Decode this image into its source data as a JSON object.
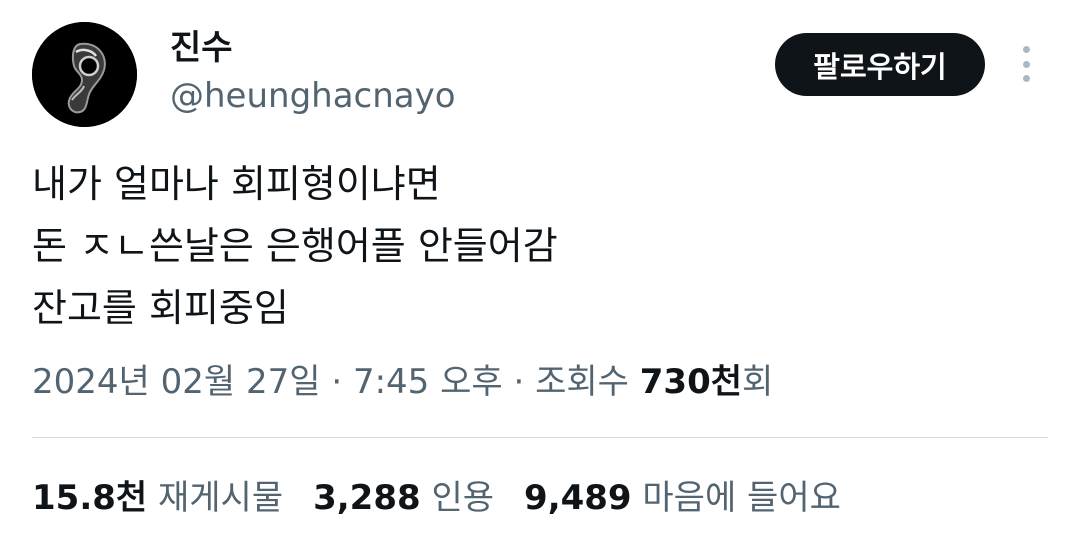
{
  "user": {
    "display_name": "진수",
    "handle": "@heunghacnayo",
    "avatar_icon": "dark-spiral-avatar"
  },
  "header": {
    "follow_label": "팔로우하기",
    "more_icon": "vertical-ellipsis-icon"
  },
  "tweet": {
    "lines": [
      "내가 얼마나 회피형이냐면",
      "돈 ㅈㄴ쓴날은 은행어플 안들어감",
      "잔고를 회피중임"
    ]
  },
  "meta": {
    "date": "2024년 02월 27일",
    "sep1": " · ",
    "time": "7:45 오후",
    "sep2": " · ",
    "views_label": "조회수 ",
    "views_count": "730천",
    "views_suffix": "회"
  },
  "stats": {
    "retweets_count": "15.8천",
    "retweets_label": "재게시물",
    "quotes_count": "3,288",
    "quotes_label": "인용",
    "likes_count": "9,489",
    "likes_label": "마음에 들어요"
  },
  "colors": {
    "text_primary": "#0f1419",
    "text_secondary": "#536471",
    "button_bg": "#0f1419",
    "divider": "#cfd9de"
  }
}
